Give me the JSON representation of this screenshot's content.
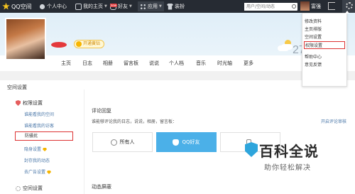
{
  "topbar": {
    "logo": "QQ空间",
    "nav": [
      {
        "label": "个人中心",
        "icon": "person-icon"
      },
      {
        "label": "我的主页",
        "icon": "home-box-icon"
      },
      {
        "label": "好友",
        "icon": "friends-icon",
        "badge": "new"
      },
      {
        "label": "应用",
        "icon": "apps-grid-icon"
      },
      {
        "label": "装扮",
        "icon": "shirt-icon"
      }
    ],
    "search_placeholder": "用户/空间/动态",
    "username": "富强",
    "menu": {
      "items": [
        "修改资料",
        "主页排版",
        "空间设置",
        "权限设置",
        "帮助中心",
        "意见反馈"
      ],
      "highlighted": "权限设置"
    }
  },
  "profile": {
    "vip_label": "开通黄钻",
    "weather_temp": "27",
    "tabs": [
      "主页",
      "日志",
      "相册",
      "留言板",
      "说说",
      "个人档",
      "音乐",
      "时光轴",
      "更多"
    ]
  },
  "settings": {
    "page_title": "空间设置",
    "sidebar": {
      "group1": "权限设置",
      "items": [
        {
          "label": "谁能看我的空间"
        },
        {
          "label": "谁能看我的访客"
        },
        {
          "label": "防骚扰",
          "selected": true
        },
        {
          "label": "隐身设置",
          "vip": true
        },
        {
          "label": "封存我的动态"
        },
        {
          "label": "去广告设置",
          "vip": true
        }
      ],
      "group2": "空间设置"
    },
    "comment_section": {
      "title": "评论回复",
      "description": "谁能够评论我的日志，说说，相册，留言板：",
      "link": "开启评论审核",
      "options": [
        "所有人",
        "QQ好友",
        ""
      ],
      "selected": "QQ好友"
    },
    "feed_section_title": "动态屏蔽"
  },
  "watermark": {
    "title": "百科全说",
    "subtitle": "助你轻松解决"
  },
  "colors": {
    "topbar_bg": "#262b33",
    "accent_blue": "#4bb0e8",
    "highlight_red": "#dd3333",
    "link_blue": "#4a77a8"
  }
}
